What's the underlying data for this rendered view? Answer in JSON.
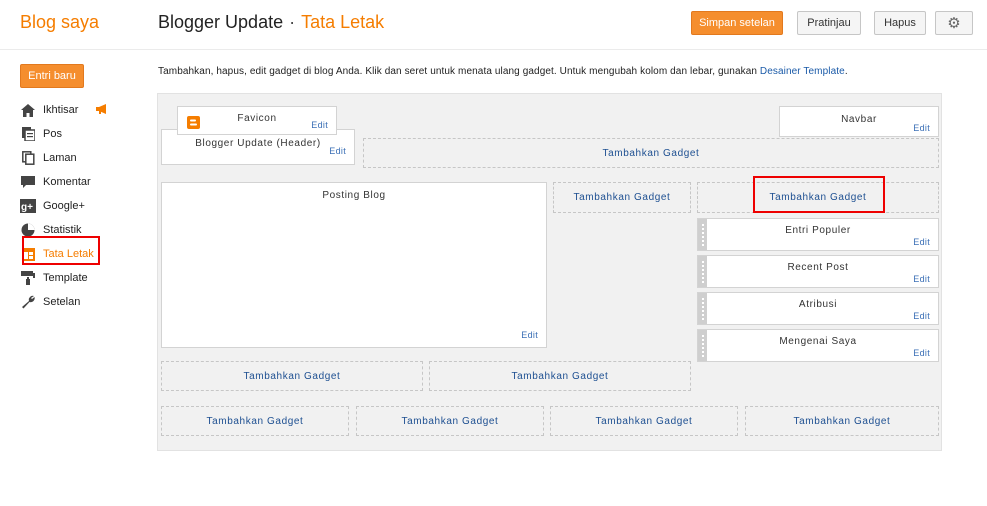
{
  "header": {
    "brand": "Blog saya",
    "blog_name": "Blogger Update",
    "separator": "·",
    "section": "Tata Letak",
    "buttons": {
      "save": "Simpan setelan",
      "preview": "Pratinjau",
      "delete": "Hapus"
    }
  },
  "sidebar": {
    "new_post": "Entri baru",
    "items": [
      {
        "label": "Ikhtisar",
        "icon": "home-icon"
      },
      {
        "label": "Pos",
        "icon": "posts-icon"
      },
      {
        "label": "Laman",
        "icon": "pages-icon"
      },
      {
        "label": "Komentar",
        "icon": "comment-icon"
      },
      {
        "label": "Google+",
        "icon": "google-plus-icon"
      },
      {
        "label": "Statistik",
        "icon": "stats-icon"
      },
      {
        "label": "Tata Letak",
        "icon": "layout-icon",
        "active": true
      },
      {
        "label": "Template",
        "icon": "paint-roller-icon"
      },
      {
        "label": "Setelan",
        "icon": "wrench-icon"
      }
    ]
  },
  "intro": {
    "text": "Tambahkan, hapus, edit gadget di blog Anda. Klik dan seret untuk menata ulang gadget. Untuk mengubah kolom dan lebar, gunakan ",
    "link": "Desainer Template",
    "end": "."
  },
  "layout": {
    "favicon": {
      "title": "Favicon",
      "edit": "Edit"
    },
    "navbar": {
      "title": "Navbar",
      "edit": "Edit"
    },
    "header_gadget": {
      "title": "Blogger Update (Header)",
      "edit": "Edit"
    },
    "main": {
      "title": "Posting Blog",
      "edit": "Edit"
    },
    "sidebar_gadgets": [
      {
        "title": "Entri Populer",
        "edit": "Edit"
      },
      {
        "title": "Recent Post",
        "edit": "Edit"
      },
      {
        "title": "Atribusi",
        "edit": "Edit"
      },
      {
        "title": "Mengenai Saya",
        "edit": "Edit"
      }
    ],
    "add_gadget": "Tambahkan Gadget"
  },
  "colors": {
    "accent": "#f57d00",
    "link": "#1d4f91",
    "highlight": "#ee0000"
  }
}
